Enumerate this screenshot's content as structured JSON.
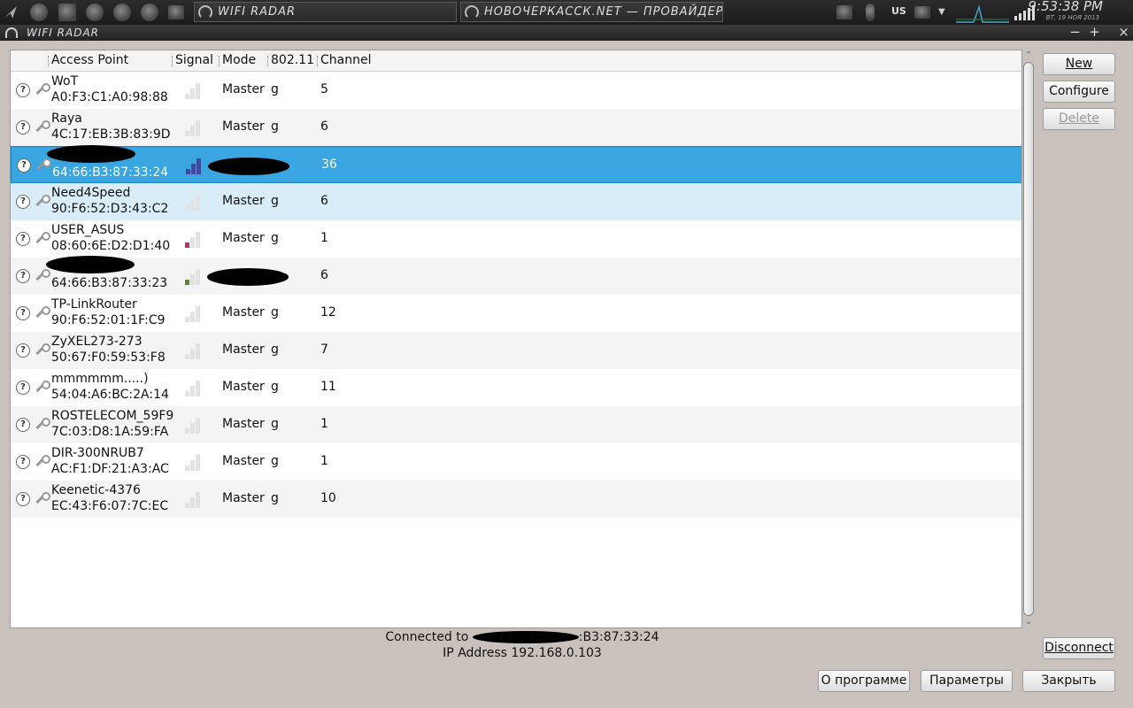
{
  "panel": {
    "tasks": [
      {
        "label": "WIFI RADAR"
      },
      {
        "label": "НОВОЧЕРКАССК.NET — ПРОВАЙДЕР ОАО ОКТЕ"
      }
    ],
    "keyboard_layout": "US",
    "clock": "9:53:38 PM",
    "date": "ВТ, 19 НОЯ 2013"
  },
  "window": {
    "title": "WIFI RADAR",
    "controls": [
      "−",
      "+",
      "×"
    ]
  },
  "columns": [
    "Access Point",
    "Signal",
    "Mode",
    "802.11",
    "Channel"
  ],
  "access_points": [
    {
      "essid": "WoT",
      "bssid": "A0:F3:C1:A0:98:88",
      "signal": 0,
      "signal_color": "#e2e2e2",
      "mode": "Master",
      "protocol": "g",
      "channel": "5"
    },
    {
      "essid": "Raya",
      "bssid": "4C:17:EB:3B:83:9D",
      "signal": 0,
      "signal_color": "#e2e2e2",
      "mode": "Master",
      "protocol": "g",
      "channel": "6"
    },
    {
      "essid": "",
      "bssid": "64:66:B3:87:33:24",
      "signal": 3,
      "signal_color": "#3a4aa0",
      "mode": "",
      "protocol": "",
      "channel": "36",
      "selected": true,
      "redacted": true
    },
    {
      "essid": "Need4Speed",
      "bssid": "90:F6:52:D3:43:C2",
      "signal": 0,
      "signal_color": "#e2e2e2",
      "mode": "Master",
      "protocol": "g",
      "channel": "6"
    },
    {
      "essid": "USER_ASUS",
      "bssid": "08:60:6E:D2:D1:40",
      "signal": 1,
      "signal_color": "#c0306a",
      "mode": "Master",
      "protocol": "g",
      "channel": "1"
    },
    {
      "essid": "",
      "bssid": "64:66:B3:87:33:23",
      "signal": 1,
      "signal_color": "#5a8a2a",
      "mode": "",
      "protocol": "",
      "channel": "6",
      "redacted": true
    },
    {
      "essid": "TP-LinkRouter",
      "bssid": "90:F6:52:01:1F:C9",
      "signal": 0,
      "signal_color": "#e2e2e2",
      "mode": "Master",
      "protocol": "g",
      "channel": "12"
    },
    {
      "essid": "ZyXEL273-273",
      "bssid": "50:67:F0:59:53:F8",
      "signal": 0,
      "signal_color": "#e2e2e2",
      "mode": "Master",
      "protocol": "g",
      "channel": "7"
    },
    {
      "essid": "mmmmmm.....)",
      "bssid": "54:04:A6:BC:2A:14",
      "signal": 0,
      "signal_color": "#e2e2e2",
      "mode": "Master",
      "protocol": "g",
      "channel": "11"
    },
    {
      "essid": "ROSTELECOM_59F9",
      "bssid": "7C:03:D8:1A:59:FA",
      "signal": 0,
      "signal_color": "#e2e2e2",
      "mode": "Master",
      "protocol": "g",
      "channel": "1"
    },
    {
      "essid": "DIR-300NRUB7",
      "bssid": "AC:F1:DF:21:A3:AC",
      "signal": 0,
      "signal_color": "#e2e2e2",
      "mode": "Master",
      "protocol": "g",
      "channel": "1"
    },
    {
      "essid": "Keenetic-4376",
      "bssid": "EC:43:F6:07:7C:EC",
      "signal": 0,
      "signal_color": "#e2e2e2",
      "mode": "Master",
      "protocol": "g",
      "channel": "10"
    }
  ],
  "side_buttons": {
    "new": "New",
    "configure": "Configure",
    "delete": "Delete",
    "disconnect": "Disconnect"
  },
  "status": {
    "connected_prefix": "Connected to",
    "connected_suffix": ":B3:87:33:24",
    "ip_line": "IP Address 192.168.0.103"
  },
  "bottom_buttons": {
    "about": "О программе",
    "settings": "Параметры",
    "close": "Закрыть"
  },
  "colors": {
    "selection": "#3aa6e1",
    "hover_row": "#d8edf8",
    "window_bg": "#c9c1bb"
  }
}
